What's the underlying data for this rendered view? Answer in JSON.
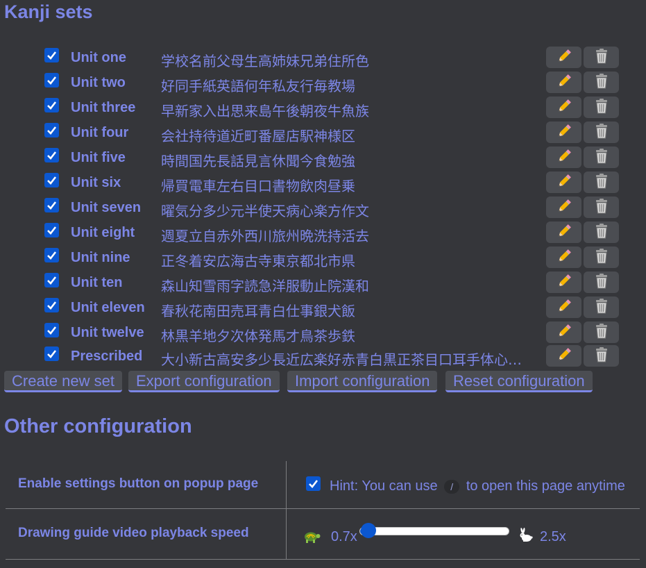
{
  "kanji_sets": {
    "title": "Kanji sets",
    "sets": [
      {
        "name": "Unit one",
        "kanji": "学校名前父母生高姉妹兄弟住所色",
        "checked": true
      },
      {
        "name": "Unit two",
        "kanji": "好同手紙英語何年私友行毎教場",
        "checked": true
      },
      {
        "name": "Unit three",
        "kanji": "早新家入出思来島午後朝夜牛魚族",
        "checked": true
      },
      {
        "name": "Unit four",
        "kanji": "会社持待道近町番屋店駅神様区",
        "checked": true
      },
      {
        "name": "Unit five",
        "kanji": "時間国先長話見言休聞今食勉強",
        "checked": true
      },
      {
        "name": "Unit six",
        "kanji": "帰買電車左右目口書物飲肉昼乗",
        "checked": true
      },
      {
        "name": "Unit seven",
        "kanji": "曜気分多少元半使天病心楽方作文",
        "checked": true
      },
      {
        "name": "Unit eight",
        "kanji": "週夏立自赤外西川旅州晩洗持活去",
        "checked": true
      },
      {
        "name": "Unit nine",
        "kanji": "正冬着安広海古寺東京都北市県",
        "checked": true
      },
      {
        "name": "Unit ten",
        "kanji": "森山知雪雨字読急洋服動止院漢和",
        "checked": true
      },
      {
        "name": "Unit eleven",
        "kanji": "春秋花南田売耳青白仕事銀犬飯",
        "checked": true
      },
      {
        "name": "Unit twelve",
        "kanji": "林黒羊地夕次体発馬才鳥茶歩鉄",
        "checked": true
      },
      {
        "name": "Prescribed",
        "kanji": "大小新古高安多少長近広楽好赤青白黒正茶目口耳手体心…",
        "checked": true
      }
    ],
    "edit_icon": "pencil-icon",
    "delete_icon": "wastebasket-icon",
    "buttons": {
      "create": "Create new set",
      "export": "Export configuration",
      "import": "Import configuration",
      "reset": "Reset configuration"
    }
  },
  "other_configuration": {
    "title": "Other configuration",
    "settings_button": {
      "label": "Enable settings button on popup page",
      "checked": true,
      "hint_before": "Hint: You can use",
      "hint_key": "/",
      "hint_after": "to open this page anytime"
    },
    "playback_speed": {
      "label": "Drawing guide video playback speed",
      "min_label": "0.7x",
      "max_label": "2.5x",
      "min": 0.7,
      "max": 2.5,
      "value": 0.8,
      "slow_icon": "turtle-icon",
      "fast_icon": "rabbit-icon"
    }
  },
  "colors": {
    "background": "#35363a",
    "accent": "#7c86e6",
    "checkbox": "#0b57d0",
    "button_bg": "#4b4d52"
  }
}
